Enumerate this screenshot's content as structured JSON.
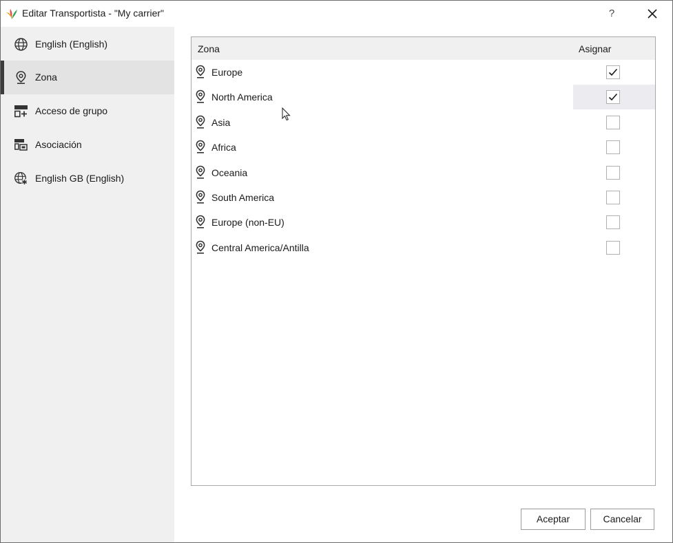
{
  "window": {
    "title": "Editar Transportista - \"My carrier\"",
    "help_label": "?"
  },
  "sidebar": {
    "items": [
      {
        "label": "English (English)",
        "icon": "globe-icon",
        "active": false
      },
      {
        "label": "Zona",
        "icon": "map-pin-icon",
        "active": true
      },
      {
        "label": "Acceso de grupo",
        "icon": "group-access-icon",
        "active": false
      },
      {
        "label": "Asociación",
        "icon": "association-icon",
        "active": false
      },
      {
        "label": "English GB (English)",
        "icon": "globe-star-icon",
        "active": false
      }
    ]
  },
  "grid": {
    "columns": {
      "zone": "Zona",
      "assign": "Asignar"
    },
    "rows": [
      {
        "label": "Europe",
        "checked": true
      },
      {
        "label": "North America",
        "checked": true
      },
      {
        "label": "Asia",
        "checked": false
      },
      {
        "label": "Africa",
        "checked": false
      },
      {
        "label": "Oceania",
        "checked": false
      },
      {
        "label": "South America",
        "checked": false
      },
      {
        "label": "Europe (non-EU)",
        "checked": false
      },
      {
        "label": "Central America/Antilla",
        "checked": false
      }
    ]
  },
  "footer": {
    "ok_label": "Aceptar",
    "cancel_label": "Cancelar"
  }
}
